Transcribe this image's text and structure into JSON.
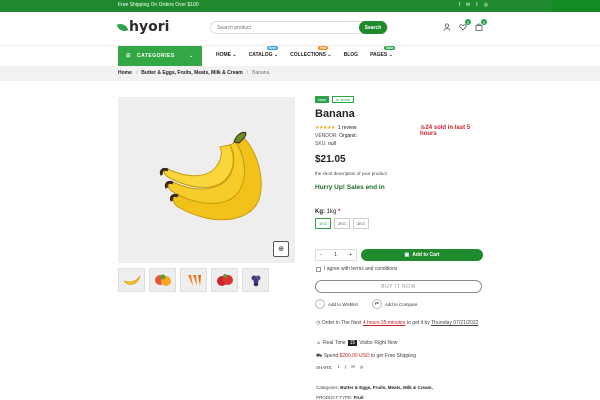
{
  "topbar": {
    "promo": "Free Shipping On Orders Over $100",
    "social": [
      "f",
      "✉",
      "t",
      "◎"
    ]
  },
  "header": {
    "logo": "hyori",
    "search_placeholder": "Search product",
    "search_button": "Search",
    "wishlist_count": "0",
    "cart_count": "0"
  },
  "nav": {
    "categories": "CATEGORIES",
    "menu": [
      {
        "label": "HOME",
        "tag": "",
        "tag_color": ""
      },
      {
        "label": "CATALOG",
        "tag": "New",
        "tag_color": "#3aa0e0"
      },
      {
        "label": "COLLECTIONS",
        "tag": "Hot",
        "tag_color": "#f08a24"
      },
      {
        "label": "BLOG",
        "tag": "",
        "tag_color": ""
      },
      {
        "label": "PAGES",
        "tag": "Sale",
        "tag_color": "#2ea34a"
      }
    ]
  },
  "breadcrumb": {
    "home": "Home",
    "category": "Butter & Eggs, Fruits, Meats, Milk & Cream",
    "current": "Banana"
  },
  "product": {
    "tag_new": "New",
    "tag_stock": "In stock",
    "title": "Banana",
    "stars": "★★★★★",
    "reviews": "1 review",
    "sold": "24 sold in last 5 hours",
    "vendor_label": "VENDOR:",
    "vendor": "Organic",
    "sku_label": "SKU:",
    "sku": "null",
    "price": "$21.05",
    "short_desc": "the short description of your product",
    "hurry": "Hurry Up! Sales end in",
    "kg_label": "Kg:",
    "kg_value": "1kg",
    "kg_required": "*",
    "kg_options": [
      "1KG",
      "2KG",
      "3KG"
    ],
    "qty_minus": "-",
    "qty_value": "1",
    "qty_plus": "+",
    "add_to_cart": "Add to Cart",
    "agree": "I agree with terms and conditions",
    "buy_now": "BUY IT NOW",
    "wishlist": "Add to Wishlist",
    "compare": "Add to Compare",
    "order_prefix": "Order in The Next",
    "order_time": "4 hours 35 minutes",
    "order_mid": "to get it by",
    "order_date": "Thursday 07/21/2022",
    "realtime_prefix": "Real Time",
    "realtime_count": "15",
    "realtime_suffix": "Visitor Right Now",
    "spend_prefix": "Spend",
    "spend_amount": "$200.00 USD",
    "spend_suffix": "to get Free Shipping",
    "share_label": "SHARE:",
    "categories_label": "Categories:",
    "categories_value": "Butter & Eggs, Fruits, Meats, Milk & Cream,",
    "type_label": "PRODUCT TYPE:",
    "type_value": "Fruit"
  }
}
